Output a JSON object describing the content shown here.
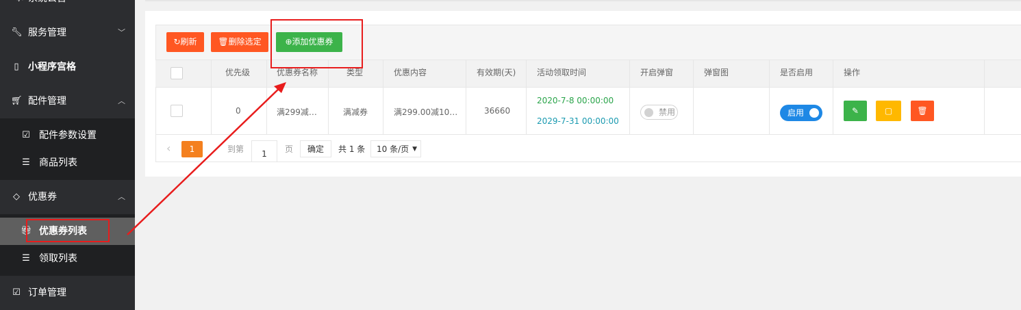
{
  "sidebar": {
    "items": [
      {
        "label": "系统公告",
        "icon": "code-icon"
      },
      {
        "label": "服务管理",
        "icon": "wrench-icon",
        "chevron": "﹀"
      },
      {
        "label": "小程序宫格",
        "icon": "mobile-icon"
      },
      {
        "label": "配件管理",
        "icon": "cart-icon",
        "chevron": "︿"
      },
      {
        "label": "优惠券",
        "icon": "diamond-icon",
        "chevron": "︿"
      },
      {
        "label": "订单管理",
        "icon": "checkbox-icon"
      }
    ],
    "sub_accessories": [
      {
        "label": "配件参数设置",
        "icon": "checkbox-icon"
      },
      {
        "label": "商品列表",
        "icon": "sliders-icon"
      }
    ],
    "sub_coupons": [
      {
        "label": "优惠券列表",
        "icon": "gift-icon",
        "active": true
      },
      {
        "label": "领取列表",
        "icon": "sliders-icon"
      }
    ]
  },
  "toolbar": {
    "refresh_label": "刷新",
    "delete_label": "删除选定",
    "add_label": "添加优惠券"
  },
  "table": {
    "headers": [
      "优先级",
      "优惠券名称",
      "类型",
      "优惠内容",
      "有效期(天)",
      "活动领取时间",
      "开启弹窗",
      "弹窗图",
      "是否启用",
      "操作"
    ],
    "rows": [
      {
        "priority": "0",
        "name": "满299减…",
        "type": "满减券",
        "content": "满299.00减10…",
        "validity": "36660",
        "start_time": "2020-7-8 00:00:00",
        "end_time": "2029-7-31 00:00:00",
        "popup_switch": "禁用",
        "enabled_switch": "启用"
      }
    ]
  },
  "pagination": {
    "prev": "‹",
    "current_page": "1",
    "goto_label": "到第",
    "goto_value": "1",
    "page_unit": "页",
    "confirm": "确定",
    "total": "共 1 条",
    "page_size": "10 条/页"
  },
  "colors": {
    "sidebar_bg": "#2c2d30",
    "danger": "#ff5722",
    "success": "#3cb34a",
    "warning": "#ffb800",
    "primary": "#1e88e5",
    "annotation_red": "#e81c1c",
    "date_green": "#2aa44a",
    "date_teal": "#1a9ab0"
  }
}
